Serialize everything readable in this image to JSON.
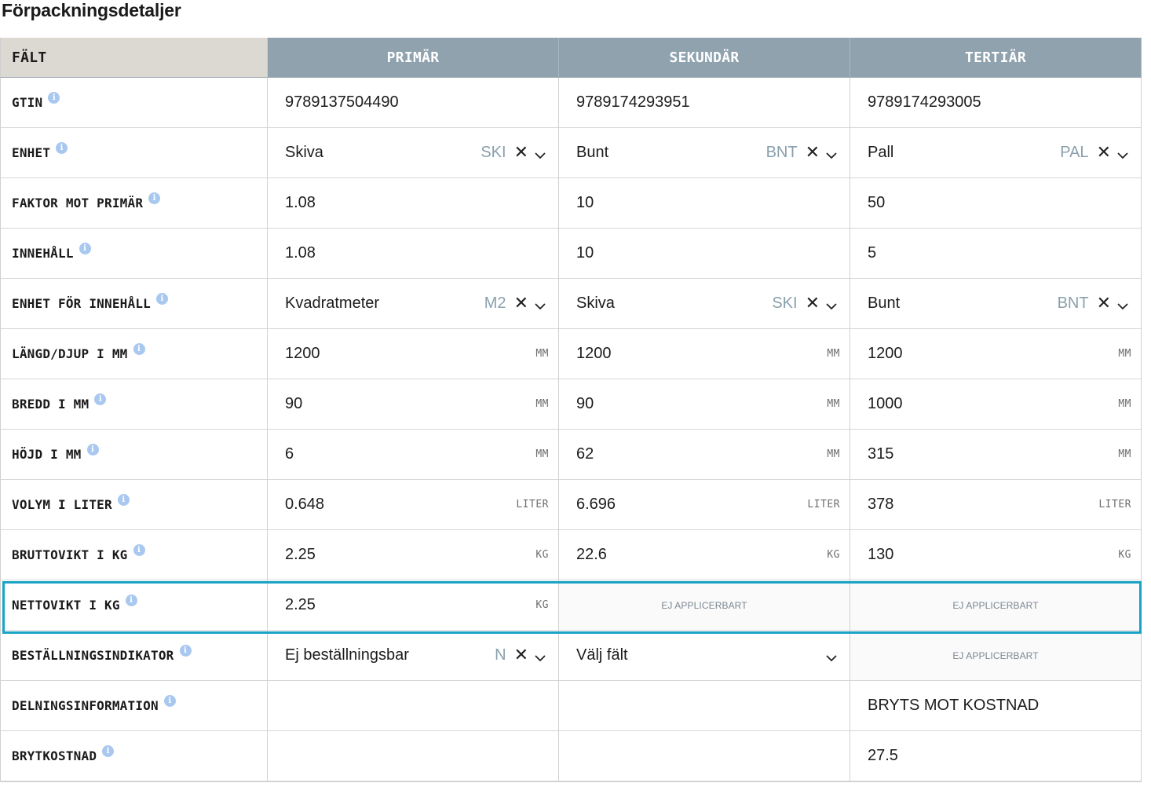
{
  "page": {
    "title": "Förpackningsdetaljer"
  },
  "table": {
    "header": {
      "field": "FÄLT",
      "primary": "PRIMÄR",
      "secondary": "SEKUNDÄR",
      "tertiary": "TERTIÄR"
    },
    "info_icon_glyph": "i",
    "clear_glyph": "✕",
    "rows": [
      {
        "label": "GTIN",
        "cells": [
          {
            "type": "text",
            "value": "9789137504490"
          },
          {
            "type": "text",
            "value": "9789174293951"
          },
          {
            "type": "text",
            "value": "9789174293005"
          }
        ]
      },
      {
        "label": "ENHET",
        "cells": [
          {
            "type": "select",
            "value": "Skiva",
            "code": "SKI"
          },
          {
            "type": "select",
            "value": "Bunt",
            "code": "BNT"
          },
          {
            "type": "select",
            "value": "Pall",
            "code": "PAL"
          }
        ]
      },
      {
        "label": "FAKTOR MOT PRIMÄR",
        "cells": [
          {
            "type": "text",
            "value": "1.08"
          },
          {
            "type": "text",
            "value": "10"
          },
          {
            "type": "text",
            "value": "50"
          }
        ]
      },
      {
        "label": "INNEHÅLL",
        "cells": [
          {
            "type": "text",
            "value": "1.08"
          },
          {
            "type": "text",
            "value": "10"
          },
          {
            "type": "text",
            "value": "5"
          }
        ]
      },
      {
        "label": "ENHET FÖR INNEHÅLL",
        "cells": [
          {
            "type": "select",
            "value": "Kvadratmeter",
            "code": "M2"
          },
          {
            "type": "select",
            "value": "Skiva",
            "code": "SKI"
          },
          {
            "type": "select",
            "value": "Bunt",
            "code": "BNT"
          }
        ]
      },
      {
        "label": "LÄNGD/DJUP I MM",
        "cells": [
          {
            "type": "unit",
            "value": "1200",
            "unit": "MM"
          },
          {
            "type": "unit",
            "value": "1200",
            "unit": "MM"
          },
          {
            "type": "unit",
            "value": "1200",
            "unit": "MM"
          }
        ]
      },
      {
        "label": "BREDD I MM",
        "cells": [
          {
            "type": "unit",
            "value": "90",
            "unit": "MM"
          },
          {
            "type": "unit",
            "value": "90",
            "unit": "MM"
          },
          {
            "type": "unit",
            "value": "1000",
            "unit": "MM"
          }
        ]
      },
      {
        "label": "HÖJD I MM",
        "cells": [
          {
            "type": "unit",
            "value": "6",
            "unit": "MM"
          },
          {
            "type": "unit",
            "value": "62",
            "unit": "MM"
          },
          {
            "type": "unit",
            "value": "315",
            "unit": "MM"
          }
        ]
      },
      {
        "label": "VOLYM I LITER",
        "cells": [
          {
            "type": "unit",
            "value": "0.648",
            "unit": "LITER"
          },
          {
            "type": "unit",
            "value": "6.696",
            "unit": "LITER"
          },
          {
            "type": "unit",
            "value": "378",
            "unit": "LITER"
          }
        ]
      },
      {
        "label": "BRUTTOVIKT I KG",
        "cells": [
          {
            "type": "unit",
            "value": "2.25",
            "unit": "KG"
          },
          {
            "type": "unit",
            "value": "22.6",
            "unit": "KG"
          },
          {
            "type": "unit",
            "value": "130",
            "unit": "KG"
          }
        ]
      },
      {
        "label": "NETTOVIKT I KG",
        "cells": [
          {
            "type": "unit",
            "value": "2.25",
            "unit": "KG"
          },
          {
            "type": "na",
            "value": "EJ APPLICERBART"
          },
          {
            "type": "na",
            "value": "EJ APPLICERBART"
          }
        ]
      },
      {
        "label": "BESTÄLLNINGSINDIKATOR",
        "cells": [
          {
            "type": "select",
            "value": "Ej beställningsbar",
            "code": "N"
          },
          {
            "type": "select-empty",
            "value": "Välj fält"
          },
          {
            "type": "na",
            "value": "EJ APPLICERBART"
          }
        ]
      },
      {
        "label": "DELNINGSINFORMATION",
        "cells": [
          {
            "type": "empty"
          },
          {
            "type": "empty"
          },
          {
            "type": "text",
            "value": "BRYTS MOT KOSTNAD"
          }
        ]
      },
      {
        "label": "BRYTKOSTNAD",
        "cells": [
          {
            "type": "empty"
          },
          {
            "type": "empty"
          },
          {
            "type": "text",
            "value": "27.5"
          }
        ]
      }
    ]
  },
  "colors": {
    "header_field_bg": "#dcd9d3",
    "header_col_bg": "#8fa2ae",
    "info_icon": "#a9c8f0",
    "highlight_border": "#1aa3c4",
    "code_text": "#8aa0ad"
  }
}
